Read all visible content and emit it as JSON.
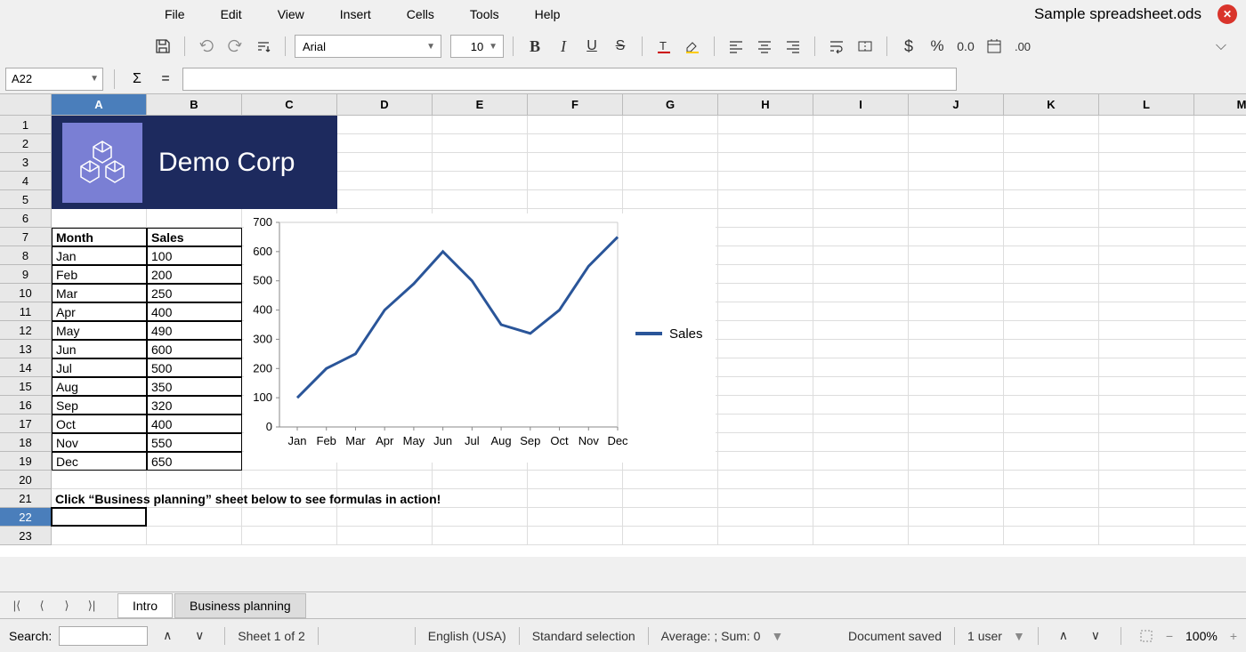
{
  "menu": {
    "items": [
      "File",
      "Edit",
      "View",
      "Insert",
      "Cells",
      "Tools",
      "Help"
    ]
  },
  "doc_title": "Sample spreadsheet.ods",
  "toolbar": {
    "font_name": "Arial",
    "font_size": "10"
  },
  "formula_bar": {
    "cell_ref": "A22",
    "formula": ""
  },
  "columns": [
    "A",
    "B",
    "C",
    "D",
    "E",
    "F",
    "G",
    "H",
    "I",
    "J",
    "K",
    "L",
    "M"
  ],
  "rows": [
    "1",
    "2",
    "3",
    "4",
    "5",
    "6",
    "7",
    "8",
    "9",
    "10",
    "11",
    "12",
    "13",
    "14",
    "15",
    "16",
    "17",
    "18",
    "19",
    "20",
    "21",
    "22",
    "23"
  ],
  "logo_text": "Demo Corp",
  "table": {
    "header_month": "Month",
    "header_sales": "Sales",
    "data": [
      {
        "month": "Jan",
        "sales": "100"
      },
      {
        "month": "Feb",
        "sales": "200"
      },
      {
        "month": "Mar",
        "sales": "250"
      },
      {
        "month": "Apr",
        "sales": "400"
      },
      {
        "month": "May",
        "sales": "490"
      },
      {
        "month": "Jun",
        "sales": "600"
      },
      {
        "month": "Jul",
        "sales": "500"
      },
      {
        "month": "Aug",
        "sales": "350"
      },
      {
        "month": "Sep",
        "sales": "320"
      },
      {
        "month": "Oct",
        "sales": "400"
      },
      {
        "month": "Nov",
        "sales": "550"
      },
      {
        "month": "Dec",
        "sales": "650"
      }
    ]
  },
  "hint": "Click “Business planning” sheet below to see formulas in action!",
  "chart_data": {
    "type": "line",
    "categories": [
      "Jan",
      "Feb",
      "Mar",
      "Apr",
      "May",
      "Jun",
      "Jul",
      "Aug",
      "Sep",
      "Oct",
      "Nov",
      "Dec"
    ],
    "series": [
      {
        "name": "Sales",
        "values": [
          100,
          200,
          250,
          400,
          490,
          600,
          500,
          350,
          320,
          400,
          550,
          650
        ]
      }
    ],
    "ylim": [
      0,
      700
    ],
    "yticks": [
      0,
      100,
      200,
      300,
      400,
      500,
      600,
      700
    ],
    "legend": "Sales",
    "title": ""
  },
  "sheet_tabs": {
    "active": "Intro",
    "inactive": "Business planning"
  },
  "status": {
    "search_label": "Search:",
    "sheet_info": "Sheet 1 of 2",
    "language": "English (USA)",
    "selection": "Standard selection",
    "summary": "Average: ; Sum: 0",
    "saved": "Document saved",
    "users": "1 user",
    "zoom": "100%"
  }
}
